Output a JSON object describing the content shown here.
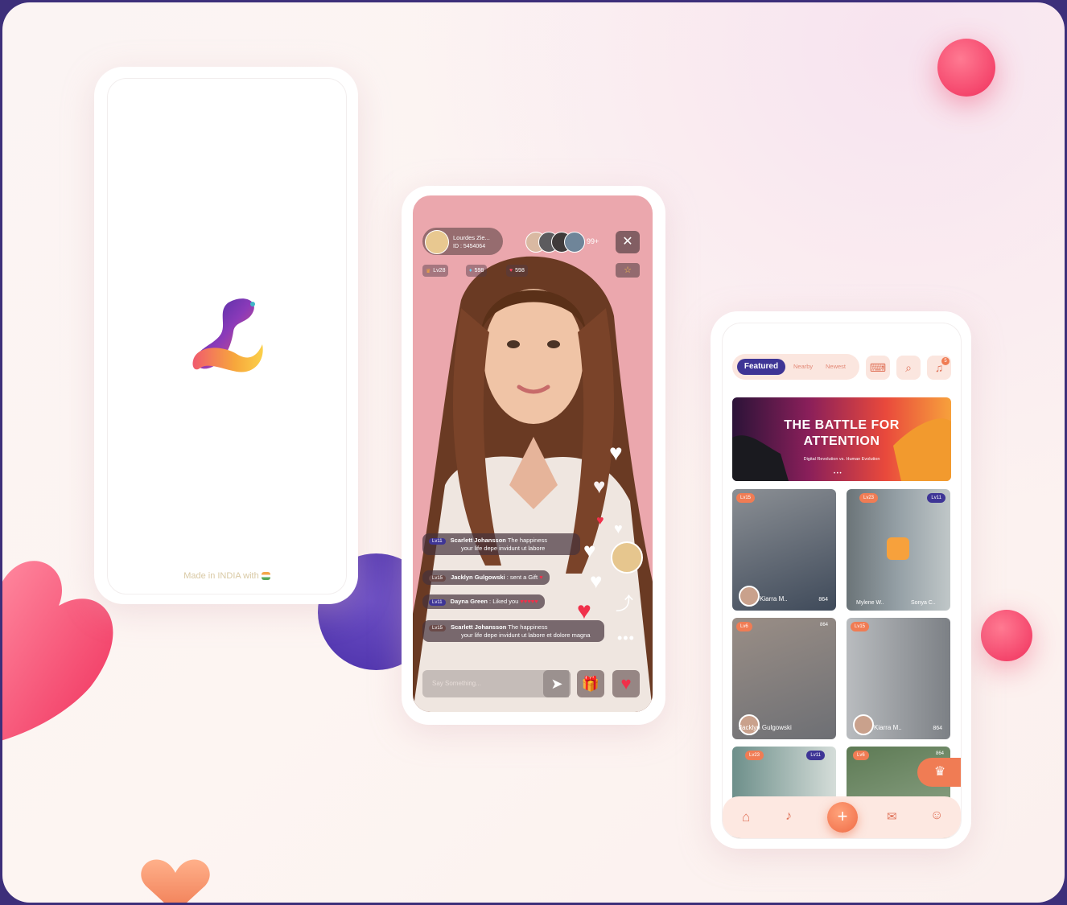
{
  "splash": {
    "footer_text": "Made in INDIA with"
  },
  "live": {
    "host_name": "Lourdes Zie...",
    "host_id": "ID : 5454064",
    "viewer_count": "99+",
    "chips": [
      "Lv28",
      "598",
      "598"
    ],
    "messages": [
      {
        "level": "Lv11",
        "name": "Scarlett Johansson",
        "text1": "The happiness",
        "text2": "your life depe  invidunt ut labore"
      },
      {
        "level": "Lv15",
        "name": "Jacklyn Gulgowski",
        "text1": ": sent a Gift",
        "text2": ""
      },
      {
        "level": "Lv11",
        "name": "Dayna Green",
        "text1": ": Liked you",
        "text2": ""
      },
      {
        "level": "Lv15",
        "name": "Scarlett Johansson",
        "text1": "The happiness",
        "text2": "your life depe  invidunt ut labore et dolore magna"
      }
    ],
    "input_placeholder": "Say Something...",
    "colors": {
      "background": "#eba7ad",
      "like": "#e8344a"
    }
  },
  "feed": {
    "tabs": [
      "Featured",
      "Nearby",
      "Newest"
    ],
    "notification_count": "5",
    "banner": {
      "title_line1": "THE BATTLE FOR",
      "title_line2": "ATTENTION",
      "subtitle": "Digital Revolution vs. Human Evolution"
    },
    "cards": [
      {
        "name": "Kiarra M..",
        "viewers": "864",
        "badge": "Lv15"
      },
      {
        "name": "Mylene W..",
        "name2": "Sonya C..",
        "badge": "Lv23",
        "badge2": "Lv11"
      },
      {
        "name": "Jacklyn Gulgowski",
        "viewers": "864",
        "badge": "Lv6"
      },
      {
        "name": "Kiarra M..",
        "viewers": "864",
        "badge": "Lv15"
      },
      {
        "badge": "Lv23",
        "badge2": "Lv11"
      },
      {
        "badge": "Lv6",
        "viewers": "864"
      }
    ],
    "nav": [
      "home-icon",
      "music-icon",
      "add-icon",
      "chat-icon",
      "profile-icon"
    ],
    "colors": {
      "accent": "#f07c54",
      "primary": "#3e3596"
    }
  }
}
